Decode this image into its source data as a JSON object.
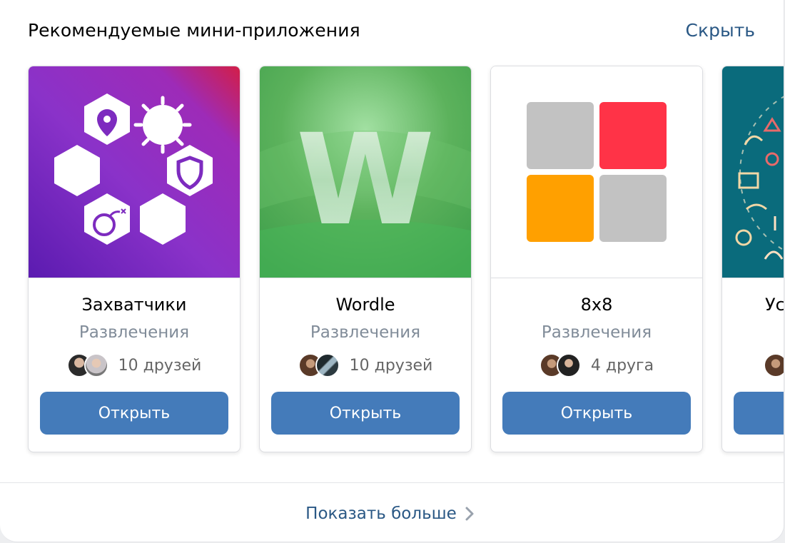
{
  "header": {
    "title": "Рекомендуемые мини-приложения",
    "hide_label": "Скрыть"
  },
  "cards": [
    {
      "title": "Захватчики",
      "category": "Развлечения",
      "friends": "10 друзей",
      "button": "Открыть"
    },
    {
      "title": "Wordle",
      "category": "Развлечения",
      "friends": "10 друзей",
      "button": "Открыть",
      "logo_letter": "W"
    },
    {
      "title": "8x8",
      "category": "Развлечения",
      "friends": "4 друга",
      "button": "Открыть"
    },
    {
      "title": "Ус",
      "category": "",
      "friends": "",
      "button": ""
    }
  ],
  "footer": {
    "show_more_label": "Показать больше"
  },
  "colors": {
    "accent": "#447bba",
    "link": "#2a5885",
    "muted": "#818c99"
  }
}
